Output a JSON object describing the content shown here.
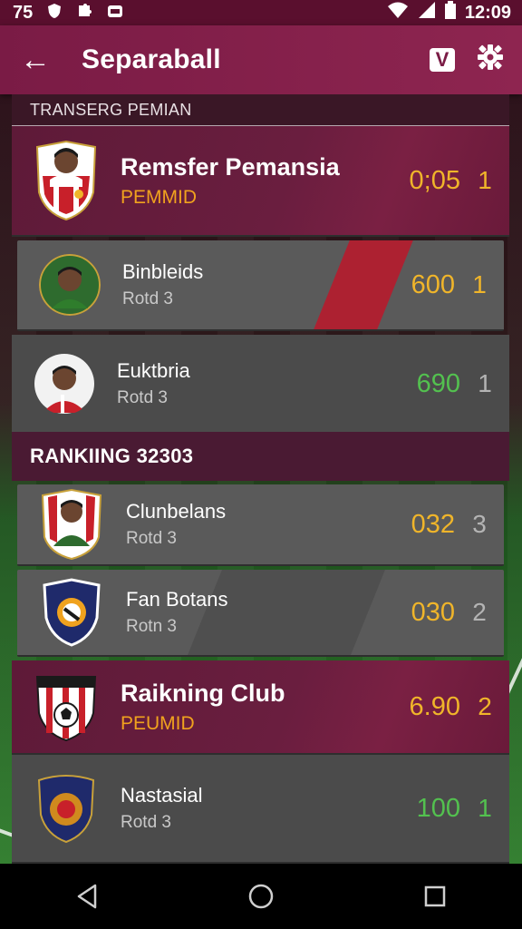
{
  "status": {
    "left_text": "75",
    "time": "12:09",
    "left_icons": [
      "shield-icon",
      "puzzle-icon",
      "app-icon"
    ],
    "right_icons": [
      "wifi-icon",
      "signal-icon",
      "battery-icon"
    ]
  },
  "appbar": {
    "title": "Separaball",
    "back_glyph": "←",
    "v_label": "V",
    "gear_glyph": "✿"
  },
  "section1": {
    "header": "TRANSERG PEMIAN",
    "rows": [
      {
        "name": "Remsfer Pemansia",
        "sub": "PEMMID",
        "score": "0;05",
        "rank": "1"
      },
      {
        "name": "Binbleids",
        "sub": "Rotd 3",
        "score": "600",
        "rank": "1"
      },
      {
        "name": "Euktbria",
        "sub": "Rotd 3",
        "score": "690",
        "rank": "1"
      }
    ]
  },
  "section2": {
    "header": "RANKIING 32303",
    "rows": [
      {
        "name": "Clunbelans",
        "sub": "Rotd 3",
        "score": "032",
        "rank": "3"
      },
      {
        "name": "Fan Botans",
        "sub": "Rotn 3",
        "score": "030",
        "rank": "2"
      },
      {
        "name": "Raikning Club",
        "sub": "PEUMID",
        "score": "6.90",
        "rank": "2"
      },
      {
        "name": "Nastasial",
        "sub": "Rotd 3",
        "score": "100",
        "rank": "1"
      }
    ]
  },
  "colors": {
    "brand": "#7a1b45",
    "gold": "#f0b52a",
    "green": "#53c14f",
    "accent_red": "#b21f2f"
  }
}
